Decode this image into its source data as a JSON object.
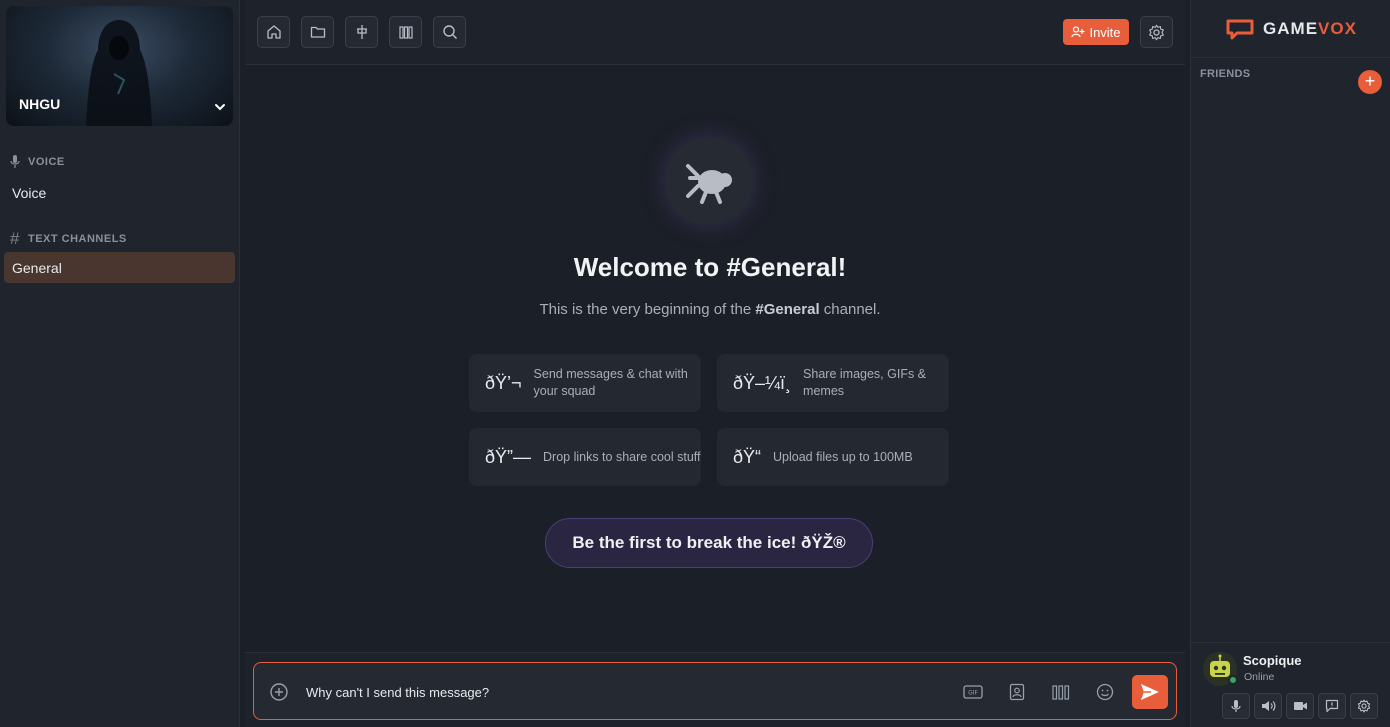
{
  "server": {
    "name": "NHGU"
  },
  "sidebar": {
    "voice_section": "VOICE",
    "voice_channel": "Voice",
    "text_section": "TEXT CHANNELS",
    "text_channel": "General"
  },
  "toolbar": {
    "icons": [
      "home-icon",
      "folder-icon",
      "pin-icon",
      "library-icon",
      "search-icon"
    ],
    "invite_label": "Invite",
    "settings_icon": "gear-icon"
  },
  "welcome": {
    "title": "Welcome to #General!",
    "sub_prefix": "This is the very beginning of the ",
    "sub_channel": "#General",
    "sub_suffix": " channel.",
    "cards": [
      {
        "emoji": "ðŸ’¬",
        "text": "Send messages & chat with your squad"
      },
      {
        "emoji": "ðŸ–¼ï¸",
        "text": "Share images, GIFs & memes"
      },
      {
        "emoji": "ðŸ”—",
        "text": "Drop links to share cool stuff"
      },
      {
        "emoji": "ðŸ“",
        "text": "Upload files up to 100MB"
      }
    ],
    "ice_button": "Be the first to break the ice! ðŸŽ®"
  },
  "composer": {
    "value": "Why can't I send this message?",
    "icons": [
      "plus-circle-icon",
      "gif-icon",
      "sticker-icon",
      "library-icon",
      "emoji-icon",
      "send-icon"
    ]
  },
  "right": {
    "brand_game": "GAME",
    "brand_vox": "VOX",
    "friends_label": "FRIENDS",
    "add_label": "+"
  },
  "user": {
    "name": "Scopique",
    "status": "Online"
  },
  "colors": {
    "accent": "#e85d3a",
    "online": "#3ba55c",
    "active_channel": "#48362f"
  }
}
